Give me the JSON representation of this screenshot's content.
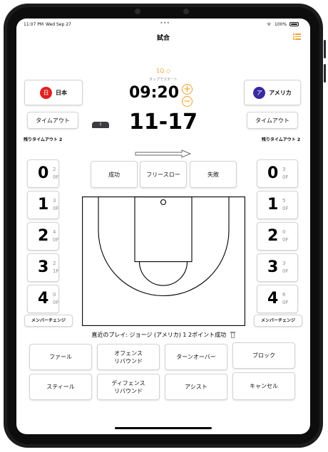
{
  "status_bar": {
    "time": "11:07 PM",
    "date": "Wed Sep 27",
    "dots": "•••",
    "wifi": "ᯤ",
    "battery": "100%"
  },
  "nav": {
    "title": "試合",
    "menu_icon": "list-icon"
  },
  "game": {
    "quarter": "1Q ◇",
    "tap_hint": "タップでスタート",
    "clock": "09:20",
    "score": "11-17",
    "possession": "1",
    "plus": "+",
    "minus": "−"
  },
  "home": {
    "badge": "日",
    "name": "日本",
    "color": "#e02020",
    "timeout_label": "タイムアウト",
    "timeouts_left": "残りタイムアウト 2"
  },
  "away": {
    "badge": "ア",
    "name": "アメリカ",
    "color": "#3a2aa0",
    "timeout_label": "タイムアウト",
    "timeouts_left": "残りタイムアウト 2"
  },
  "home_players": [
    {
      "number": "0",
      "pts": "2",
      "fouls": "0F"
    },
    {
      "number": "1",
      "pts": "3",
      "fouls": "0F"
    },
    {
      "number": "2",
      "pts": "4",
      "fouls": "0F"
    },
    {
      "number": "3",
      "pts": "2",
      "fouls": "1F"
    },
    {
      "number": "4",
      "pts": "0",
      "fouls": "0F"
    }
  ],
  "away_players": [
    {
      "number": "0",
      "pts": "3",
      "fouls": "0F"
    },
    {
      "number": "1",
      "pts": "5",
      "fouls": "0F"
    },
    {
      "number": "2",
      "pts": "0",
      "fouls": "0F"
    },
    {
      "number": "3",
      "pts": "3",
      "fouls": "0F"
    },
    {
      "number": "4",
      "pts": "6",
      "fouls": "0F"
    }
  ],
  "member_change": "メンバーチェンジ",
  "shot_buttons": {
    "made": "成功",
    "free_throw": "フリースロー",
    "missed": "失敗"
  },
  "recent_play": "直近のプレイ: ジョージ (アメリカ) 1 2ポイント成功",
  "trash_icon": "trash-icon",
  "actions": {
    "foul": "ファール",
    "off_rebound": "オフェンス\nリバウンド",
    "turnover": "ターンオーバー",
    "block": "ブロック",
    "steal": "スティール",
    "def_rebound": "ディフェンス\nリバウンド",
    "assist": "アシスト",
    "cancel": "キャンセル"
  },
  "colors": {
    "accent": "#f0a030"
  }
}
